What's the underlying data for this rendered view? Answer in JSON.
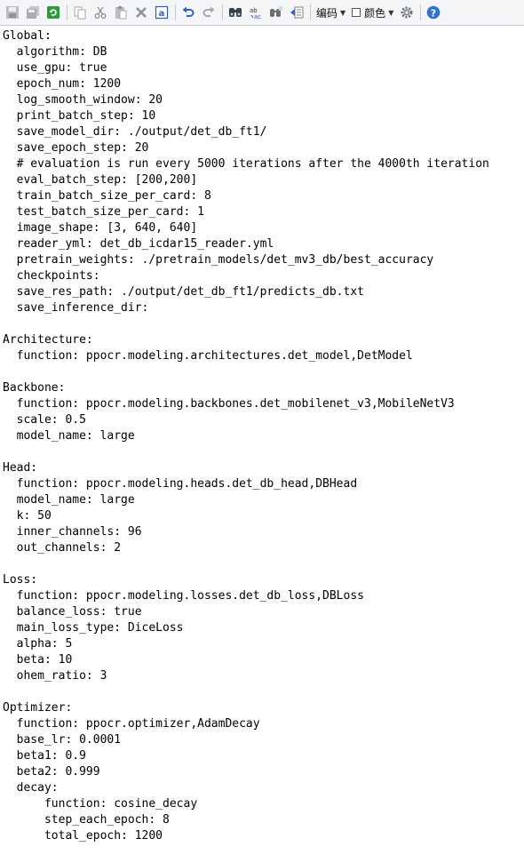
{
  "toolbar": {
    "encoding_label": "编码",
    "color_label": "颜色"
  },
  "editor": {
    "lines": [
      "Global:",
      "  algorithm: DB",
      "  use_gpu: true",
      "  epoch_num: 1200",
      "  log_smooth_window: 20",
      "  print_batch_step: 10",
      "  save_model_dir: ./output/det_db_ft1/",
      "  save_epoch_step: 20",
      "  # evaluation is run every 5000 iterations after the 4000th iteration",
      "  eval_batch_step: [200,200]",
      "  train_batch_size_per_card: 8",
      "  test_batch_size_per_card: 1",
      "  image_shape: [3, 640, 640]",
      "  reader_yml: det_db_icdar15_reader.yml",
      "  pretrain_weights: ./pretrain_models/det_mv3_db/best_accuracy",
      "  checkpoints:",
      "  save_res_path: ./output/det_db_ft1/predicts_db.txt",
      "  save_inference_dir:",
      "",
      "Architecture:",
      "  function: ppocr.modeling.architectures.det_model,DetModel",
      "",
      "Backbone:",
      "  function: ppocr.modeling.backbones.det_mobilenet_v3,MobileNetV3",
      "  scale: 0.5",
      "  model_name: large",
      "",
      "Head:",
      "  function: ppocr.modeling.heads.det_db_head,DBHead",
      "  model_name: large",
      "  k: 50",
      "  inner_channels: 96",
      "  out_channels: 2",
      "",
      "Loss:",
      "  function: ppocr.modeling.losses.det_db_loss,DBLoss",
      "  balance_loss: true",
      "  main_loss_type: DiceLoss",
      "  alpha: 5",
      "  beta: 10",
      "  ohem_ratio: 3",
      "",
      "Optimizer:",
      "  function: ppocr.optimizer,AdamDecay",
      "  base_lr: 0.0001",
      "  beta1: 0.9",
      "  beta2: 0.999",
      "  decay:",
      "      function: cosine_decay",
      "      step_each_epoch: 8",
      "      total_epoch: 1200"
    ]
  }
}
